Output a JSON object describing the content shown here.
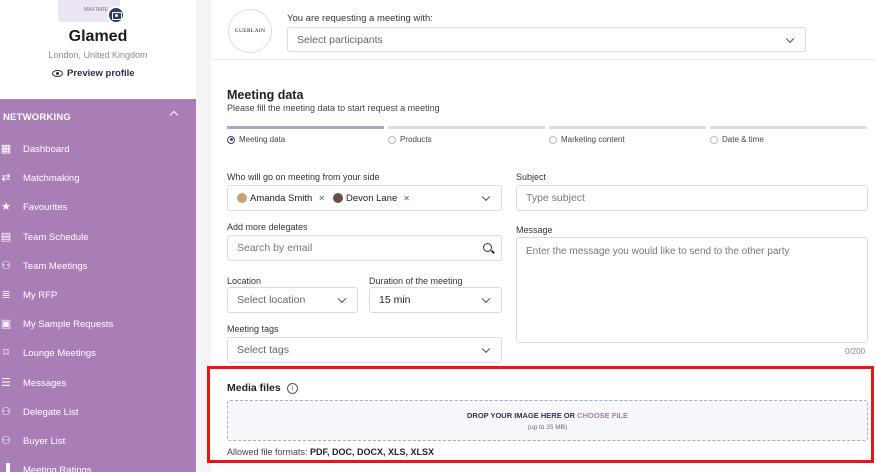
{
  "profile": {
    "company_name": "Glamed",
    "location": "London, United Kingdom",
    "preview_label": "Preview profile",
    "card_scribble": "✧ ∿",
    "card_text": "MAXTARE"
  },
  "nav": {
    "section_label": "NETWORKING",
    "items": [
      {
        "label": "Dashboard",
        "icon": "dashboard-icon",
        "glyph": "▦"
      },
      {
        "label": "Matchmaking",
        "icon": "matchmaking-icon",
        "glyph": "⇄"
      },
      {
        "label": "Favourites",
        "icon": "star-icon",
        "glyph": "★"
      },
      {
        "label": "Team Schedule",
        "icon": "calendar-icon",
        "glyph": "▤"
      },
      {
        "label": "Team Meetings",
        "icon": "team-icon",
        "glyph": "⚇"
      },
      {
        "label": "My RFP",
        "icon": "rfp-icon",
        "glyph": "≣"
      },
      {
        "label": "My Sample Requests",
        "icon": "sample-icon",
        "glyph": "▣"
      },
      {
        "label": "Lounge Meetings",
        "icon": "lounge-icon",
        "glyph": "⌑"
      },
      {
        "label": "Messages",
        "icon": "messages-icon",
        "glyph": "☰"
      },
      {
        "label": "Delegate List",
        "icon": "delegates-icon",
        "glyph": "⚇"
      },
      {
        "label": "Buyer List",
        "icon": "buyers-icon",
        "glyph": "⚇"
      },
      {
        "label": "Meeting Ratings",
        "icon": "ratings-icon",
        "glyph": "▐"
      }
    ]
  },
  "request": {
    "logo_text": "GUERLAIN",
    "label": "You are requesting a meeting with:",
    "participants_placeholder": "Select participants"
  },
  "meeting": {
    "title": "Meeting data",
    "subtitle": "Please fill the meeting data to start request a meeting",
    "steps": [
      "Meeting data",
      "Products",
      "Marketing content",
      "Date & time"
    ],
    "active_step": 0
  },
  "form": {
    "who_label": "Who will go on meeting from your side",
    "attendees": [
      "Amanda Smith",
      "Devon Lane"
    ],
    "delegates_label": "Add more delegates",
    "delegates_placeholder": "Search by email",
    "location_label": "Location",
    "location_placeholder": "Select location",
    "duration_label": "Duration of the meeting",
    "duration_value": "15 min",
    "tags_label": "Meeting tags",
    "tags_placeholder": "Select tags",
    "subject_label": "Subject",
    "subject_placeholder": "Type subject",
    "message_label": "Message",
    "message_placeholder": "Enter the message you would like to send to the other party",
    "message_counter": "0/200"
  },
  "media": {
    "title": "Media files",
    "drop_text": "DROP YOUR IMAGE HERE OR",
    "choose_text": "CHOOSE FILE",
    "size_note": "(up to 25 MB)",
    "allowed_label": "Allowed file formats:",
    "allowed_formats": "PDF, DOC, DOCX, XLS, XLSX"
  },
  "colors": {
    "sidebar": "#a97db6",
    "highlight": "#e8141c",
    "accent": "#3b4670"
  }
}
